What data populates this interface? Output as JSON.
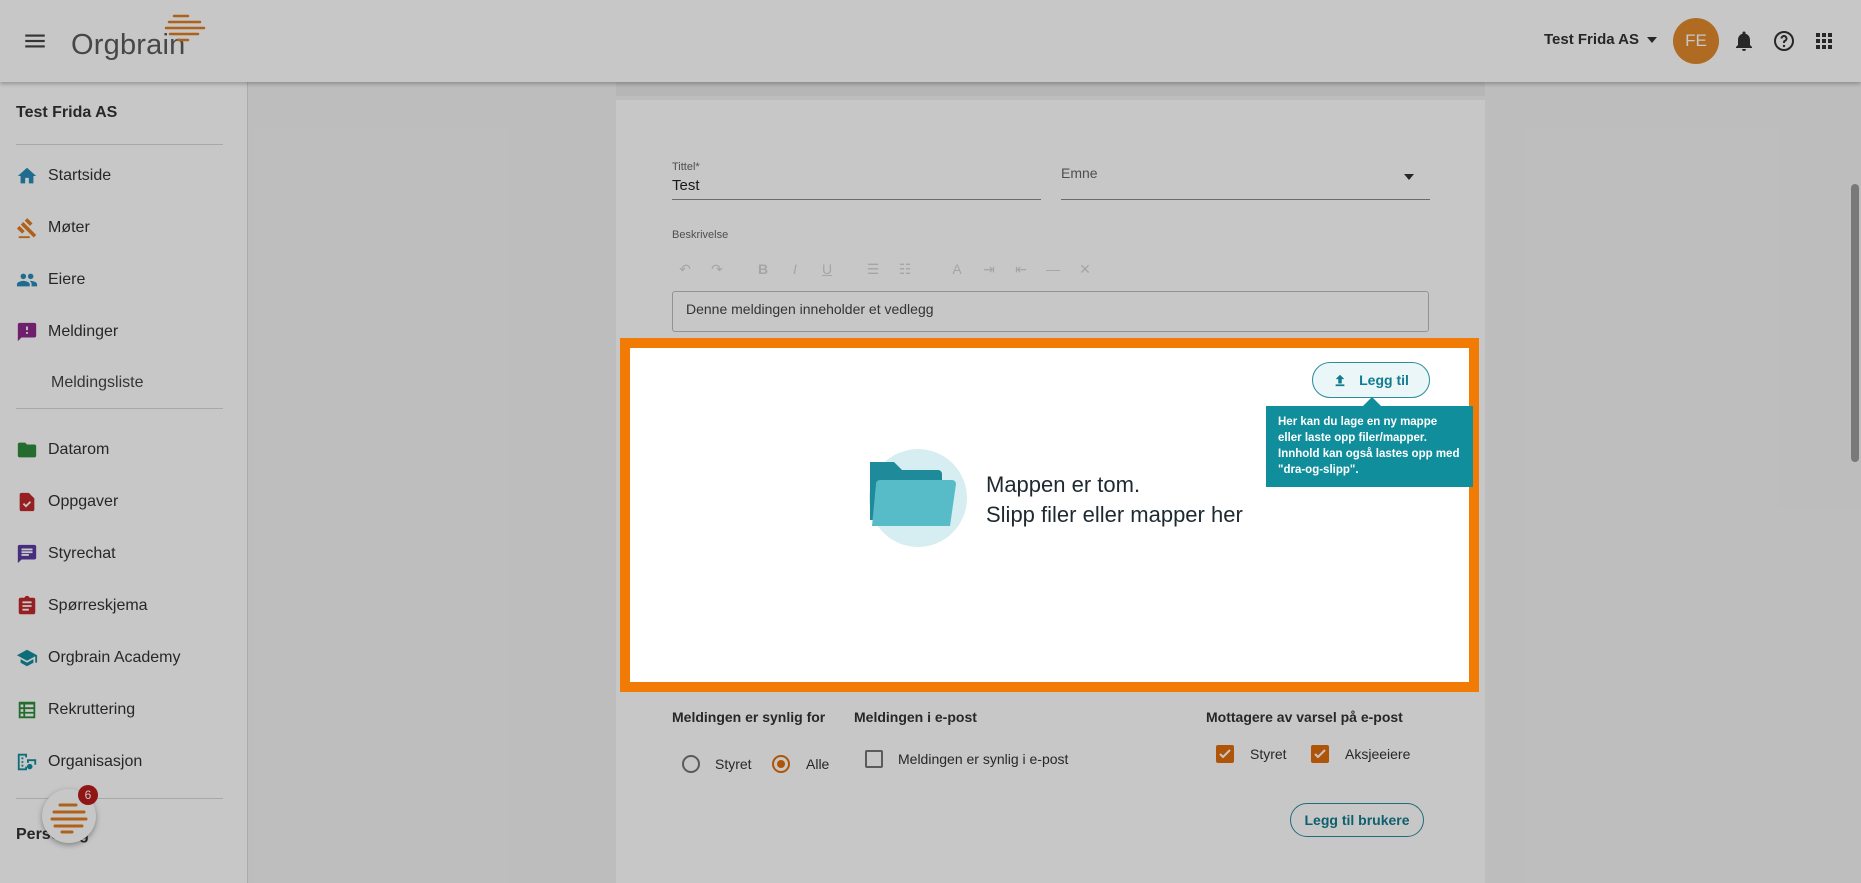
{
  "header": {
    "logo_text": "Orgbrain",
    "company": "Test Frida AS",
    "avatar_initials": "FE",
    "accent_color": "#f27b06"
  },
  "sidebar": {
    "org_name": "Test Frida AS",
    "items": [
      {
        "label": "Startside",
        "icon": "home-icon",
        "color": "#2a8bb8"
      },
      {
        "label": "Møter",
        "icon": "gavel-icon",
        "color": "#e07b20"
      },
      {
        "label": "Eiere",
        "icon": "people-icon",
        "color": "#2a8bb8"
      },
      {
        "label": "Meldinger",
        "icon": "message-alert-icon",
        "color": "#8e2a8c"
      },
      {
        "label": "Meldingsliste",
        "icon": "",
        "color": ""
      },
      {
        "label": "Datarom",
        "icon": "folder-icon",
        "color": "#2e8b3a"
      },
      {
        "label": "Oppgaver",
        "icon": "task-icon",
        "color": "#c0282c"
      },
      {
        "label": "Styrechat",
        "icon": "chat-icon",
        "color": "#5a3aa0"
      },
      {
        "label": "Spørreskjema",
        "icon": "clipboard-icon",
        "color": "#c0282c"
      },
      {
        "label": "Orgbrain Academy",
        "icon": "school-icon",
        "color": "#118e9c"
      },
      {
        "label": "Rekruttering",
        "icon": "list-icon",
        "color": "#2e8b3a"
      },
      {
        "label": "Organisasjon",
        "icon": "org-icon",
        "color": "#118e9c"
      }
    ],
    "personal_label": "Personlig",
    "fab_count": "6"
  },
  "form": {
    "title_label": "Tittel*",
    "title_value": "Test",
    "topic_label": "Emne",
    "description_label": "Beskrivelse",
    "description_value": "Denne meldingen inneholder et vedlegg"
  },
  "dropzone": {
    "empty_line1": "Mappen er tom.",
    "empty_line2": "Slipp filer eller mapper her",
    "add_button": "Legg til",
    "tooltip": "Her kan du lage en ny mappe eller laste opp filer/mapper. Innhold kan også lastes opp med \"dra-og-slipp\"."
  },
  "visibility": {
    "label": "Meldingen er synlig for",
    "options": [
      "Styret",
      "Alle"
    ],
    "selected": "Alle"
  },
  "email": {
    "label": "Meldingen i e-post",
    "checkbox_label": "Meldingen er synlig i e-post",
    "checked": false
  },
  "recipients": {
    "label": "Mottagere av varsel på e-post",
    "options": [
      {
        "label": "Styret",
        "checked": true
      },
      {
        "label": "Aksjeeiere",
        "checked": true
      }
    ],
    "add_users_button": "Legg til brukere"
  }
}
